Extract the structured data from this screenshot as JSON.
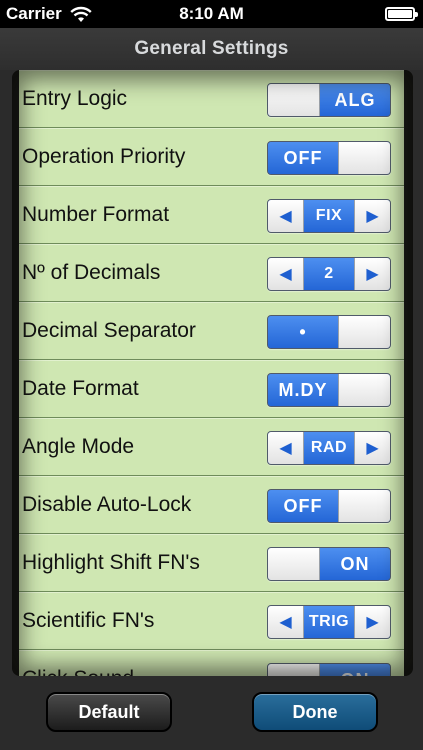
{
  "status_bar": {
    "carrier": "Carrier",
    "time": "8:10 AM"
  },
  "header": {
    "title": "General Settings"
  },
  "settings": [
    {
      "label": "Entry Logic",
      "control": "toggle",
      "value": "ALG",
      "knob": "left"
    },
    {
      "label": "Operation Priority",
      "control": "toggle",
      "value": "OFF",
      "knob": "right"
    },
    {
      "label": "Number Format",
      "control": "stepper",
      "value": "FIX"
    },
    {
      "label": "Nº of Decimals",
      "control": "stepper",
      "value": "2"
    },
    {
      "label": "Decimal Separator",
      "control": "toggle",
      "value": "•",
      "knob": "right"
    },
    {
      "label": "Date Format",
      "control": "toggle",
      "value": "M.DY",
      "knob": "right"
    },
    {
      "label": "Angle Mode",
      "control": "stepper",
      "value": "RAD"
    },
    {
      "label": "Disable Auto-Lock",
      "control": "toggle",
      "value": "OFF",
      "knob": "right"
    },
    {
      "label": "Highlight Shift FN's",
      "control": "toggle",
      "value": "ON",
      "knob": "left"
    },
    {
      "label": "Scientific FN's",
      "control": "stepper",
      "value": "TRIG"
    },
    {
      "label": "Click Sound",
      "control": "toggle",
      "value": "ON",
      "knob": "left"
    }
  ],
  "stepper_icons": {
    "left": "left-arrow-icon",
    "right": "right-arrow-icon"
  },
  "footer": {
    "default_label": "Default",
    "done_label": "Done"
  },
  "colors": {
    "row_bg": "#cfe7b2",
    "control_blue": "#2f6fd8",
    "done_button": "#1a5d8a"
  }
}
